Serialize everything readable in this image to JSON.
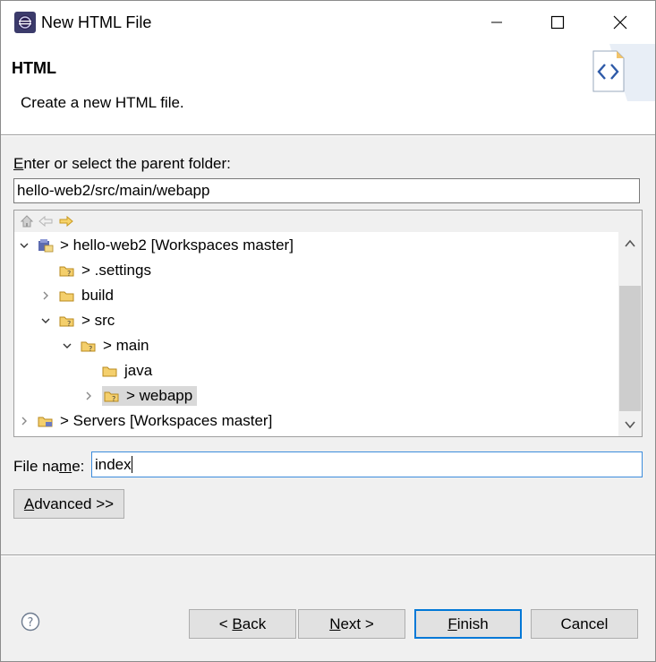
{
  "window": {
    "title": "New HTML File"
  },
  "banner": {
    "title": "HTML",
    "description": "Create a new HTML file."
  },
  "parent_folder": {
    "label_prefix": "",
    "label_mnemonic": "E",
    "label_rest": "nter or select the parent folder:",
    "value": "hello-web2/src/main/webapp"
  },
  "tree": {
    "items": [
      {
        "label": "> hello-web2 [Workspaces master]",
        "expanded": true
      },
      {
        "label": "> .settings",
        "expanded": null
      },
      {
        "label": "build",
        "expanded": false
      },
      {
        "label": "> src",
        "expanded": true
      },
      {
        "label": "> main",
        "expanded": true
      },
      {
        "label": "java",
        "expanded": null
      },
      {
        "label": "> webapp",
        "expanded": false,
        "selected": true
      },
      {
        "label": "> Servers [Workspaces master]",
        "expanded": false
      }
    ]
  },
  "file_name": {
    "label_prefix": "File na",
    "label_mnemonic": "m",
    "label_rest": "e:",
    "value": "index"
  },
  "buttons": {
    "advanced_mnemonic": "A",
    "advanced_rest": "dvanced >>",
    "back_prefix": "< ",
    "back_mnemonic": "B",
    "back_rest": "ack",
    "next_mnemonic": "N",
    "next_rest": "ext >",
    "finish_mnemonic": "F",
    "finish_rest": "inish",
    "cancel": "Cancel"
  },
  "colors": {
    "accent": "#0078d7",
    "selection": "#d9d9d9",
    "folder": "#e8b040"
  }
}
